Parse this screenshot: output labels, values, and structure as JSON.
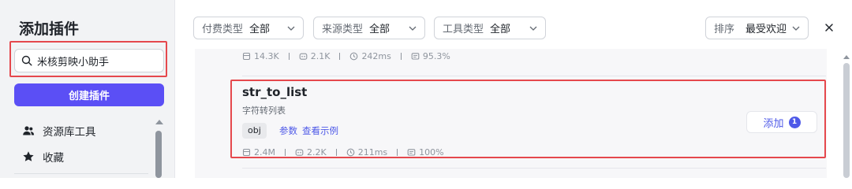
{
  "sidebar": {
    "title": "添加插件",
    "search": {
      "value": "米核剪映小助手",
      "placeholder": ""
    },
    "create_label": "创建插件",
    "items": [
      {
        "label": "资源库工具",
        "icon": "users-icon"
      },
      {
        "label": "收藏",
        "icon": "star-icon"
      }
    ]
  },
  "filters": {
    "pay": {
      "label": "付费类型",
      "value": "全部"
    },
    "source": {
      "label": "来源类型",
      "value": "全部"
    },
    "tool": {
      "label": "工具类型",
      "value": "全部"
    },
    "sort": {
      "label": "排序",
      "value": "最受欢迎"
    }
  },
  "previous_plugin_stats": {
    "uses": "14.3K",
    "bots": "2.1K",
    "latency": "242ms",
    "success": "95.3%"
  },
  "plugin": {
    "title": "str_to_list",
    "description": "字符转列表",
    "tag": "obj",
    "params_link": "参数",
    "example_link": "查看示例",
    "stats": {
      "uses": "2.4M",
      "bots": "2.2K",
      "latency": "211ms",
      "success": "100%"
    },
    "add_label": "添加",
    "add_badge": "1"
  },
  "colors": {
    "accent": "#5b4ff5",
    "link": "#4e59e8",
    "highlight": "#e5484d"
  }
}
